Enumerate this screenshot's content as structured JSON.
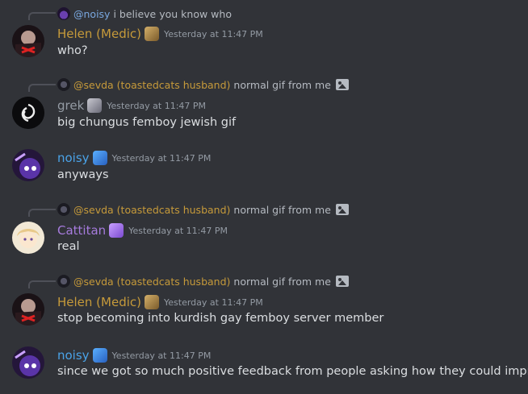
{
  "colors": {
    "helen": "#c69a3a",
    "grek": "#949ba4",
    "noisy": "#4aa3e8",
    "cattitan": "#a67bdc",
    "sevda": "#c69a3a",
    "reply_noisy": "#7aa8e0"
  },
  "messages": [
    {
      "reply": {
        "name": "@noisy",
        "text": "i believe you know who",
        "has_image_icon": false
      },
      "author": "Helen (Medic)",
      "timestamp": "Yesterday at 11:47 PM",
      "content": "who?"
    },
    {
      "reply": {
        "name": "@sevda (toastedcats husband)",
        "text": "normal gif from me",
        "has_image_icon": true
      },
      "author": "grek",
      "timestamp": "Yesterday at 11:47 PM",
      "content": "big chungus femboy jewish gif"
    },
    {
      "author": "noisy",
      "timestamp": "Yesterday at 11:47 PM",
      "content": "anyways"
    },
    {
      "reply": {
        "name": "@sevda (toastedcats husband)",
        "text": "normal gif from me",
        "has_image_icon": true
      },
      "author": "Cattitan",
      "timestamp": "Yesterday at 11:47 PM",
      "content": "real"
    },
    {
      "reply": {
        "name": "@sevda (toastedcats husband)",
        "text": "normal gif from me",
        "has_image_icon": true
      },
      "author": "Helen (Medic)",
      "timestamp": "Yesterday at 11:47 PM",
      "content": "stop becoming into kurdish gay femboy server member"
    },
    {
      "author": "noisy",
      "timestamp": "Yesterday at 11:47 PM",
      "content": "since we got so much positive feedback from people asking how they could improve"
    }
  ]
}
